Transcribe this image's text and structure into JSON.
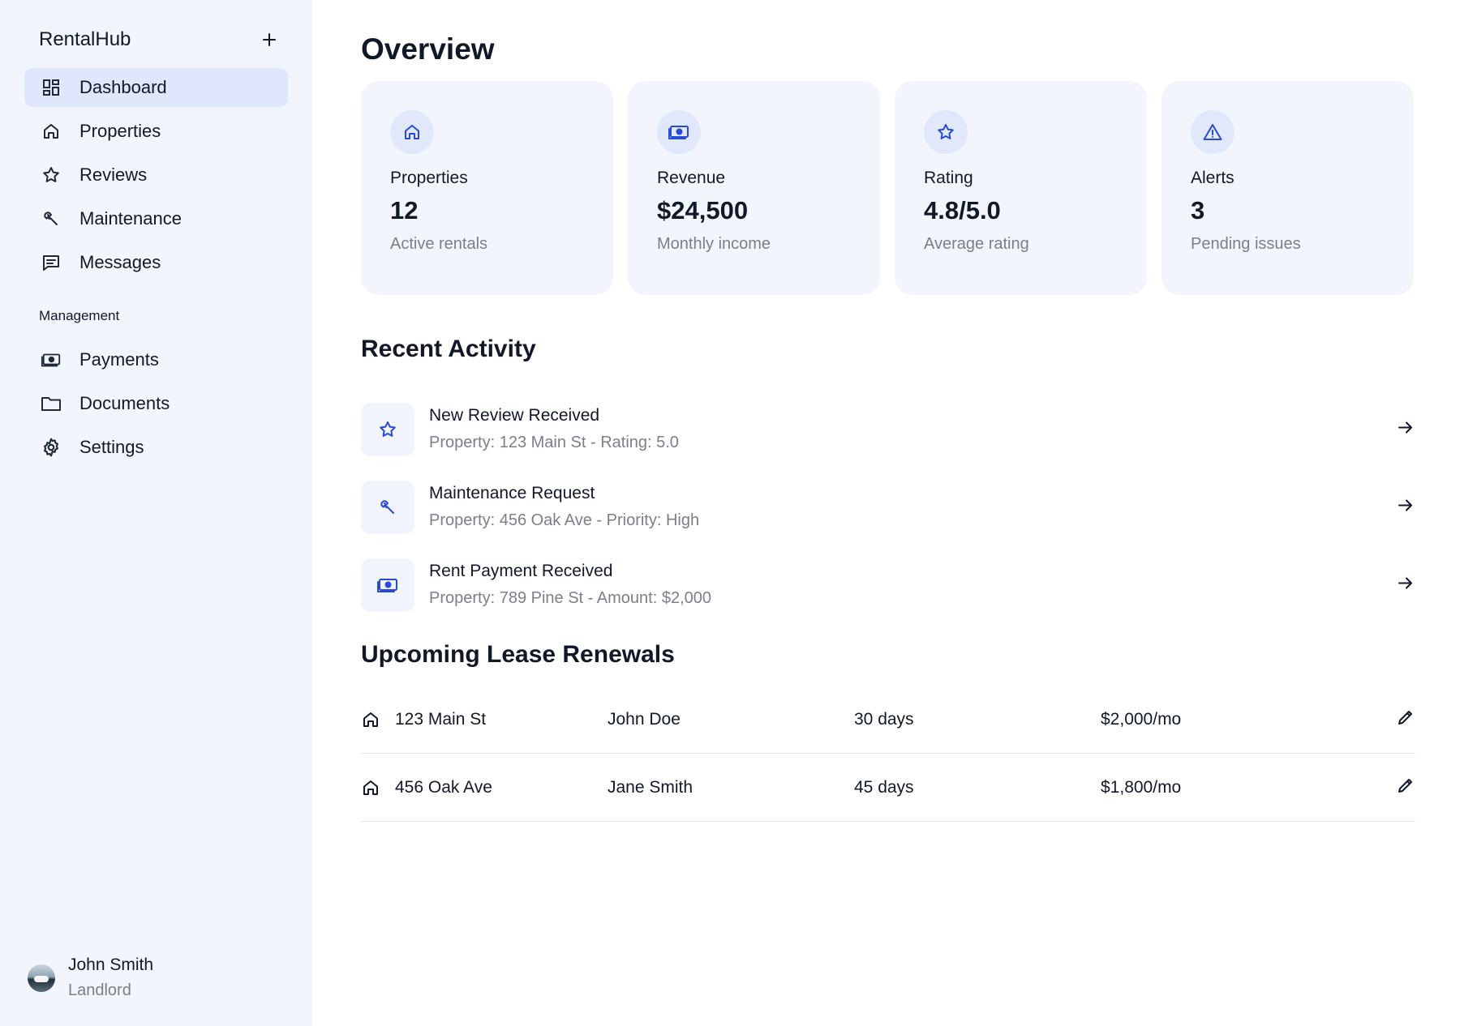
{
  "sidebar": {
    "brand": "RentalHub",
    "nav_items": [
      {
        "label": "Dashboard",
        "icon": "dashboard-icon",
        "active": true
      },
      {
        "label": "Properties",
        "icon": "home-icon"
      },
      {
        "label": "Reviews",
        "icon": "star-icon"
      },
      {
        "label": "Maintenance",
        "icon": "wrench-icon"
      },
      {
        "label": "Messages",
        "icon": "message-icon"
      }
    ],
    "section_label": "Management",
    "management_items": [
      {
        "label": "Payments",
        "icon": "cash-icon"
      },
      {
        "label": "Documents",
        "icon": "folder-icon"
      },
      {
        "label": "Settings",
        "icon": "gear-icon"
      }
    ],
    "user": {
      "name": "John Smith",
      "role": "Landlord"
    }
  },
  "main": {
    "title": "Overview",
    "stats": [
      {
        "label": "Properties",
        "value": "12",
        "sub": "Active rentals",
        "icon": "home-icon"
      },
      {
        "label": "Revenue",
        "value": "$24,500",
        "sub": "Monthly income",
        "icon": "cash-icon"
      },
      {
        "label": "Rating",
        "value": "4.8/5.0",
        "sub": "Average rating",
        "icon": "star-icon"
      },
      {
        "label": "Alerts",
        "value": "3",
        "sub": "Pending issues",
        "icon": "warning-icon"
      }
    ],
    "activity_title": "Recent Activity",
    "activity": [
      {
        "title": "New Review Received",
        "sub": "Property: 123 Main St - Rating: 5.0",
        "icon": "star-icon"
      },
      {
        "title": "Maintenance Request",
        "sub": "Property: 456 Oak Ave - Priority: High",
        "icon": "wrench-icon"
      },
      {
        "title": "Rent Payment Received",
        "sub": "Property: 789 Pine St - Amount: $2,000",
        "icon": "cash-icon"
      }
    ],
    "leases_title": "Upcoming Lease Renewals",
    "leases": [
      {
        "property": "123 Main St",
        "tenant": "John Doe",
        "days": "30 days",
        "rent": "$2,000/mo"
      },
      {
        "property": "456 Oak Ave",
        "tenant": "Jane Smith",
        "days": "45 days",
        "rent": "$1,800/mo"
      }
    ]
  },
  "colors": {
    "accent": "#2a4ad6",
    "sidebar_bg": "#f3f5fd",
    "active_bg": "#e0e6fb",
    "card_bg": "#f3f5fd",
    "muted_text": "#7b7f87"
  }
}
